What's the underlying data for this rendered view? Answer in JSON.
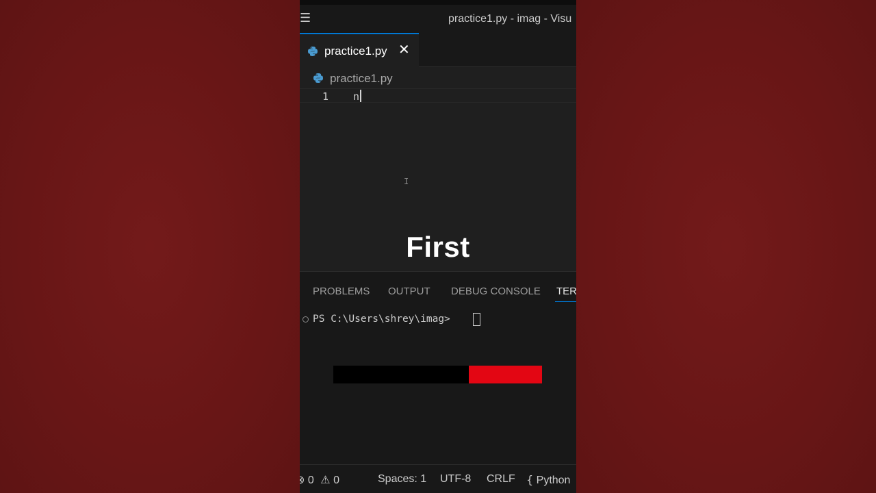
{
  "window": {
    "title": "practice1.py - imag - Visu"
  },
  "editor": {
    "tab_label": "practice1.py",
    "breadcrumb": "practice1.py",
    "line_number": "1",
    "line_text": "n"
  },
  "overlay": {
    "caption": "First"
  },
  "panel": {
    "tabs": [
      "PROBLEMS",
      "OUTPUT",
      "DEBUG CONSOLE",
      "TERI"
    ],
    "active_tab": "TERI",
    "terminal_prompt": "PS C:\\Users\\shrey\\imag>",
    "progress_fraction": 0.35
  },
  "statusbar": {
    "errors": "0",
    "warnings": "0",
    "spaces": "Spaces: 1",
    "encoding": "UTF-8",
    "eol": "CRLF",
    "language": "Python"
  },
  "colors": {
    "background": "#6b1717",
    "accent": "#0078d4",
    "progress_fill": "#e30613"
  }
}
